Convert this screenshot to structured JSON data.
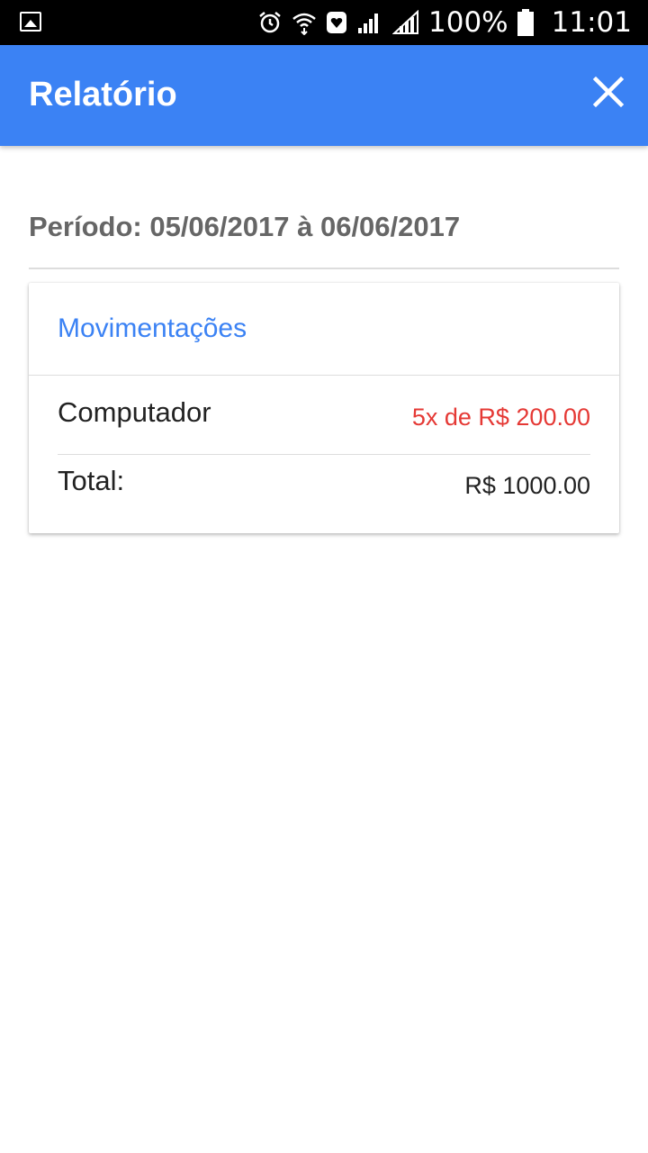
{
  "status_bar": {
    "battery": "100%",
    "time": "11:01"
  },
  "app_bar": {
    "title": "Relatório"
  },
  "period": {
    "text": "Período: 05/06/2017 à 06/06/2017"
  },
  "card": {
    "header": "Movimentações",
    "items": [
      {
        "name": "Computador",
        "value": "5x de R$ 200.00"
      }
    ],
    "total_label": "Total:",
    "total_value": "R$ 1000.00"
  },
  "colors": {
    "primary": "#3b82f4",
    "negative": "#e53935",
    "status_bar": "#000000"
  }
}
